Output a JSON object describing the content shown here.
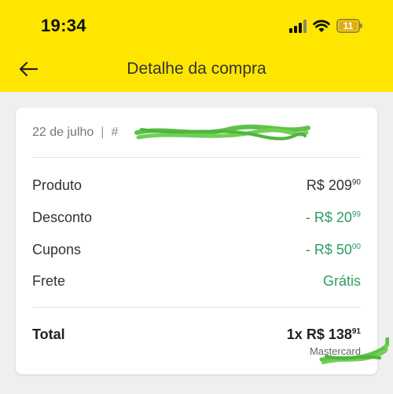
{
  "status_bar": {
    "time": "19:34",
    "battery": "11"
  },
  "header": {
    "title": "Detalhe da compra",
    "back_icon": "arrow-left-icon"
  },
  "order": {
    "date": "22 de julho",
    "separator": "|",
    "id_prefix": "#"
  },
  "summary": [
    {
      "label": "Produto",
      "amount": "R$ 209",
      "cents": "90",
      "color": "#333333"
    },
    {
      "label": "Desconto",
      "amount": "- R$ 20",
      "cents": "99",
      "color": "#2c9f5d"
    },
    {
      "label": "Cupons",
      "amount": "- R$ 50",
      "cents": "00",
      "color": "#2c9f5d"
    },
    {
      "label": "Frete",
      "amount": "Grátis",
      "cents": "",
      "color": "#2c9f5d"
    }
  ],
  "total": {
    "label": "Total",
    "amount": "1x R$ 138",
    "cents": "91",
    "payment_method": "Mastercard"
  },
  "colors": {
    "header_background": "#ffe600",
    "positive_green": "#2c9f5d",
    "redaction_green": "#5fc248"
  }
}
